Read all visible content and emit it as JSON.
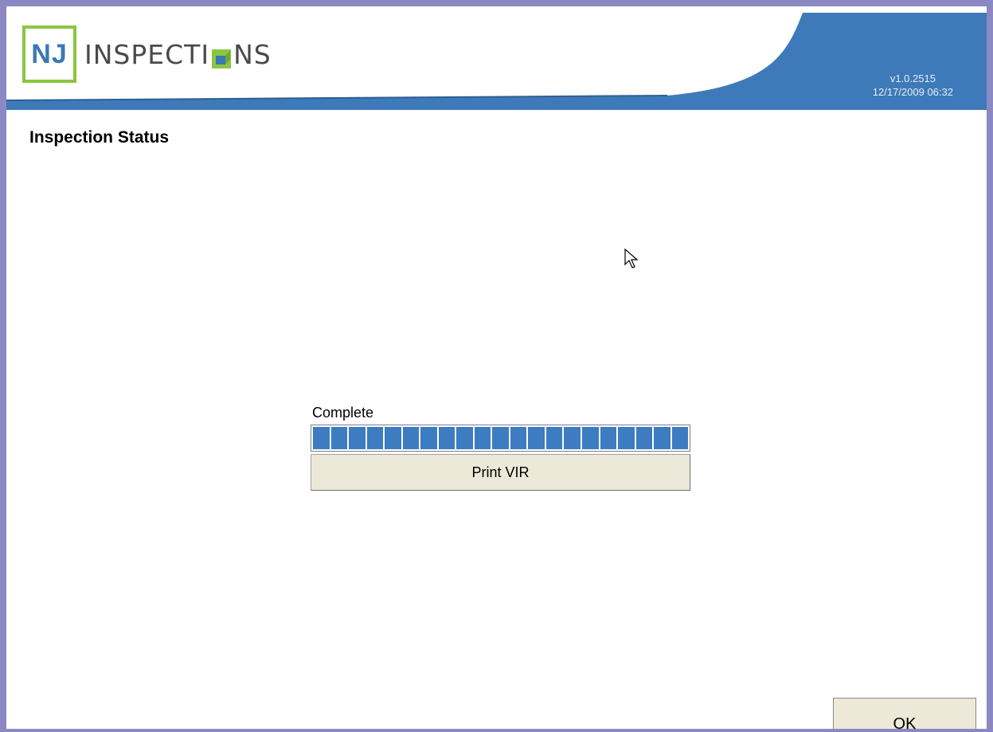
{
  "header": {
    "logo_nj": "NJ",
    "logo_word_left": "INSPECTI",
    "logo_word_right": "NS",
    "version": "v1.0.2515",
    "datetime": "12/17/2009 06:32",
    "colors": {
      "brand_green": "#8cc63f",
      "brand_blue": "#3a78b5",
      "header_blue": "#3e7ab9"
    }
  },
  "page": {
    "title": "Inspection Status"
  },
  "status": {
    "label": "Complete",
    "progress_fraction": 1.0,
    "segment_count": 21,
    "print_button": "Print VIR"
  },
  "footer": {
    "ok_button": "OK"
  },
  "icons": [
    "mouse-pointer-icon"
  ]
}
